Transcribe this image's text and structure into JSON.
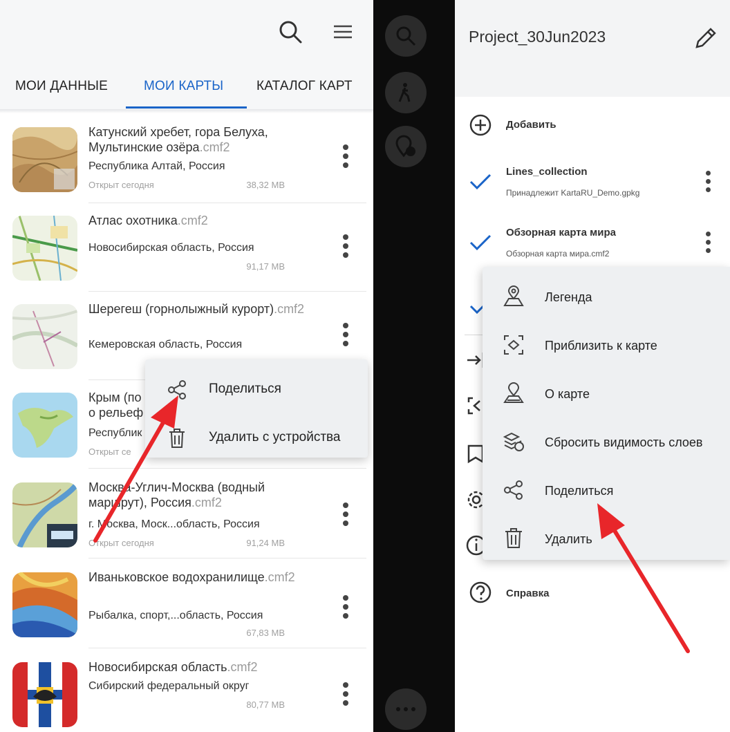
{
  "left": {
    "tabs": [
      {
        "label": "МОИ ДАННЫЕ"
      },
      {
        "label": "МОИ КАРТЫ"
      },
      {
        "label": "КАТАЛОГ КАРТ"
      }
    ],
    "maps": [
      {
        "title": "Катунский хребет, гора Белуха, Мультинские озёра",
        "ext": ".cmf2",
        "region": "Республика Алтай, Россия",
        "opened": "Открыт сегодня",
        "size": "38,32 MB"
      },
      {
        "title": "Атлас охотника",
        "ext": ".cmf2",
        "region": "Новосибирская область, Россия",
        "opened": "",
        "size": "91,17 MB"
      },
      {
        "title": "Шерегеш (горнолыжный курорт)",
        "ext": ".cmf2",
        "region": "Кемеровская область, Россия",
        "opened": "",
        "size": ""
      },
      {
        "title": "Крым (по",
        "ext": "",
        "title2": "о рельеф",
        "region": "Республик",
        "opened": "Открыт се",
        "size": ""
      },
      {
        "title": "Москва-Углич-Москва (водный маршрут), Россия",
        "ext": ".cmf2",
        "region": "г. Москва, Моск...область, Россия",
        "opened": "Открыт сегодня",
        "size": "91,24 MB"
      },
      {
        "title": "Иваньковское водохранилище",
        "ext": ".cmf2",
        "region": "Рыбалка, спорт,...область, Россия",
        "opened": "",
        "size": "67,83 MB"
      },
      {
        "title": "Новосибирская область",
        "ext": ".cmf2",
        "region": "Сибирский федеральный округ",
        "opened": "",
        "size": "80,77 MB"
      }
    ],
    "context_menu": [
      {
        "label": "Поделиться",
        "icon": "share-icon"
      },
      {
        "label": "Удалить с устройства",
        "icon": "trash-icon"
      }
    ]
  },
  "right": {
    "project_title": "Project_30Jun2023",
    "add_label": "Добавить",
    "layers": [
      {
        "name": "Lines_collection",
        "sub": "Принадлежит KartaRU_Demo.gpkg"
      },
      {
        "name": "Обзорная карта мира",
        "sub": "Обзорная карта мира.cmf2"
      }
    ],
    "help_label": "Справка",
    "context_menu": [
      {
        "label": "Легенда",
        "icon": "legend-map-icon"
      },
      {
        "label": "Приблизить к карте",
        "icon": "zoom-to-extent-icon"
      },
      {
        "label": "О карте",
        "icon": "map-info-icon"
      },
      {
        "label": "Сбросить видимость слоев",
        "icon": "layers-reset-icon"
      },
      {
        "label": "Поделиться",
        "icon": "share-icon"
      },
      {
        "label": "Удалить",
        "icon": "trash-icon"
      }
    ]
  },
  "colors": {
    "accent": "#1a64c8",
    "arrow": "#e8262a",
    "strip": "#0c0c0c"
  }
}
